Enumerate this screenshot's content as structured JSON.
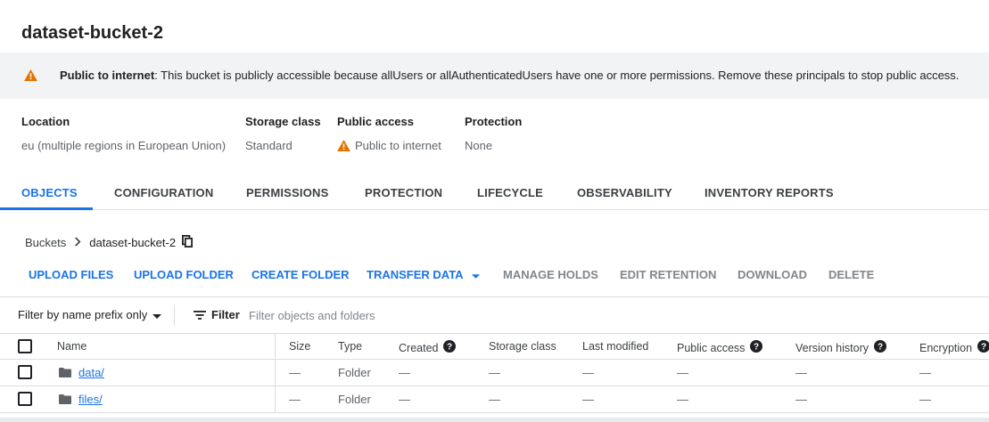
{
  "bucket": {
    "title": "dataset-bucket-2"
  },
  "alert": {
    "bold": "Public to internet",
    "message": ": This bucket is publicly accessible because allUsers or allAuthenticatedUsers have one or more permissions. Remove these principals to stop public access.",
    "icon": "warning-icon",
    "color": "#e37400"
  },
  "meta": {
    "location": {
      "label": "Location",
      "value": "eu (multiple regions in European Union)"
    },
    "storage_class": {
      "label": "Storage class",
      "value": "Standard"
    },
    "public_access": {
      "label": "Public access",
      "value": "Public to internet"
    },
    "protection": {
      "label": "Protection",
      "value": "None"
    }
  },
  "tabs": [
    {
      "label": "OBJECTS",
      "active": true
    },
    {
      "label": "CONFIGURATION"
    },
    {
      "label": "PERMISSIONS"
    },
    {
      "label": "PROTECTION"
    },
    {
      "label": "LIFECYCLE"
    },
    {
      "label": "OBSERVABILITY"
    },
    {
      "label": "INVENTORY REPORTS"
    }
  ],
  "breadcrumb": {
    "root": "Buckets",
    "current": "dataset-bucket-2"
  },
  "actions": [
    {
      "label": "UPLOAD FILES",
      "enabled": true
    },
    {
      "label": "UPLOAD FOLDER",
      "enabled": true
    },
    {
      "label": "CREATE FOLDER",
      "enabled": true
    },
    {
      "label": "TRANSFER DATA",
      "enabled": true
    },
    {
      "label": "MANAGE HOLDS",
      "enabled": false
    },
    {
      "label": "EDIT RETENTION",
      "enabled": false
    },
    {
      "label": "DOWNLOAD",
      "enabled": false
    },
    {
      "label": "DELETE",
      "enabled": false
    }
  ],
  "filter": {
    "mode": "Filter by name prefix only",
    "button": "Filter",
    "placeholder": "Filter objects and folders"
  },
  "table": {
    "headers": {
      "name": "Name",
      "size": "Size",
      "type": "Type",
      "created": "Created",
      "storage_class": "Storage class",
      "last_modified": "Last modified",
      "public_access": "Public access",
      "version_history": "Version history",
      "encryption": "Encryption"
    },
    "rows": [
      {
        "name": "data/",
        "size": "—",
        "type": "Folder",
        "created": "—",
        "storage_class": "—",
        "last_modified": "—",
        "public_access": "—",
        "version_history": "—",
        "encryption": "—"
      },
      {
        "name": "files/",
        "size": "—",
        "type": "Folder",
        "created": "—",
        "storage_class": "—",
        "last_modified": "—",
        "public_access": "—",
        "version_history": "—",
        "encryption": "—"
      }
    ]
  },
  "colors": {
    "accent": "#1a73e8",
    "warning": "#e37400",
    "alert_bg": "#f1f3f4"
  }
}
